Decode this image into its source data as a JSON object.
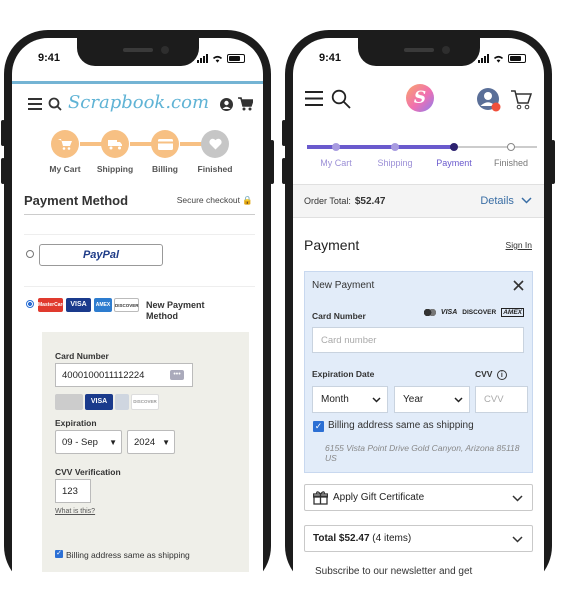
{
  "left_phone": {
    "status_time": "9:41",
    "brand": "Scrapbook.com",
    "steps": [
      {
        "label": "My Cart",
        "done": true
      },
      {
        "label": "Shipping",
        "done": true
      },
      {
        "label": "Billing",
        "done": true
      },
      {
        "label": "Finished",
        "done": false
      }
    ],
    "title": "Payment Method",
    "secure_label": "Secure checkout",
    "paypal_label": "PayPal",
    "card_logos": [
      "MasterCard",
      "VISA",
      "AMEX",
      "DISCOVER"
    ],
    "new_payment_label": "New Payment Method",
    "card_number_label": "Card Number",
    "card_number_value": "4000100011112224",
    "expiration_label": "Expiration",
    "exp_month": "09 - Sep",
    "exp_year": "2024",
    "cvv_label": "CVV Verification",
    "cvv_value": "123",
    "whats_this": "What is this?",
    "billing_same_label": "Billing address same as shipping"
  },
  "right_phone": {
    "status_time": "9:41",
    "logo_letter": "S",
    "progress": [
      {
        "label": "My Cart"
      },
      {
        "label": "Shipping"
      },
      {
        "label": "Payment"
      },
      {
        "label": "Finished"
      }
    ],
    "order_total_label": "Order Total:",
    "order_total_value": "$52.47",
    "details_label": "Details",
    "payment_heading": "Payment",
    "sign_in": "Sign In",
    "new_payment_title": "New Payment",
    "card_number_label": "Card Number",
    "card_brands": [
      "VISA",
      "DISCOVER",
      "AMEX"
    ],
    "card_number_placeholder": "Card number",
    "expiration_label": "Expiration Date",
    "cvv_label": "CVV",
    "month_value": "Month",
    "year_value": "Year",
    "cvv_placeholder": "CVV",
    "billing_same_label": "Billing address same as shipping",
    "address": "6155 Vista Point Drive Gold Canyon, Arizona 85118 US",
    "gift_label": "Apply Gift Certificate",
    "total_label": "Total $52.47",
    "total_items": "(4 items)",
    "newsletter": "Subscribe to our newsletter and get"
  },
  "colors": {
    "accent_orange": "#f7c083",
    "accent_purple": "#6a5acd",
    "link_blue": "#3a6ea5",
    "panel_blue": "#e2ecf9"
  }
}
